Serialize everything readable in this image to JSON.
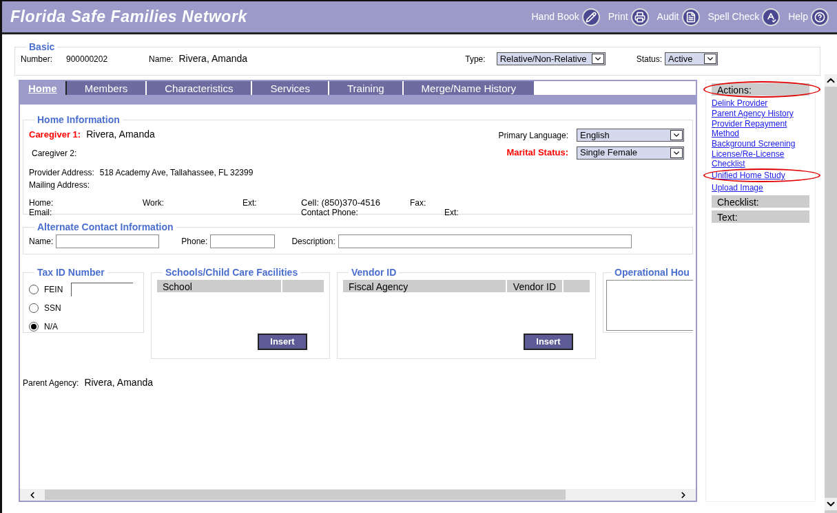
{
  "app": {
    "title": "Florida Safe Families Network"
  },
  "toolbar": [
    {
      "label": "Hand Book",
      "kind": "pencil"
    },
    {
      "label": "Print",
      "kind": "printer"
    },
    {
      "label": "Audit",
      "kind": "document"
    },
    {
      "label": "Spell Check",
      "kind": "spellcheck"
    },
    {
      "label": "Help",
      "kind": "help"
    }
  ],
  "basic": {
    "legend": "Basic",
    "number_label": "Number:",
    "number": "900000202",
    "name_label": "Name:",
    "name": "Rivera, Amanda",
    "type_label": "Type:",
    "type": "Relative/Non-Relative",
    "status_label": "Status:",
    "status": "Active"
  },
  "tabs": [
    {
      "label": "Home",
      "selected": true
    },
    {
      "label": "Members",
      "selected": false
    },
    {
      "label": "Characteristics",
      "selected": false
    },
    {
      "label": "Services",
      "selected": false
    },
    {
      "label": "Training",
      "selected": false
    },
    {
      "label": "Merge/Name History",
      "selected": false
    }
  ],
  "home_information": {
    "legend": "Home Information",
    "caregiver1_label": "Caregiver 1:",
    "caregiver1": "Rivera, Amanda",
    "caregiver2_label": "Caregiver 2:",
    "language_label": "Primary Language:",
    "language": "English",
    "marital_label": "Marital Status:",
    "marital": "Single Female",
    "provider_address_label": "Provider Address:",
    "provider_address": "518 Academy Ave, Tallahassee, FL 32399",
    "mailing_address_label": "Mailing Address:",
    "home_label": "Home:",
    "work_label": "Work:",
    "ext_label": "Ext:",
    "cell": "Cell: (850)370-4516",
    "fax_label": "Fax:",
    "email_label": "Email:",
    "contact_phone_label": "Contact Phone:",
    "ext2_label": "Ext:"
  },
  "alternate_contact": {
    "legend": "Alternate Contact Information",
    "name_label": "Name:",
    "phone_label": "Phone:",
    "description_label": "Description:"
  },
  "tax_id": {
    "legend": "Tax ID Number",
    "options": [
      {
        "label": "FEIN",
        "selected": false,
        "kind": "field"
      },
      {
        "label": "SSN",
        "selected": false,
        "kind": "plain"
      },
      {
        "label": "N/A",
        "selected": true,
        "kind": "plain"
      }
    ]
  },
  "schools": {
    "legend": "Schools/Child Care Facilities",
    "columns": [
      "School"
    ],
    "button": "Insert"
  },
  "vendor": {
    "legend": "Vendor ID",
    "columns": [
      "Fiscal Agency",
      "Vendor ID"
    ],
    "button": "Insert"
  },
  "operational_hours": {
    "legend": "Operational Hou"
  },
  "parent_agency": {
    "label": "Parent Agency:",
    "value": "Rivera, Amanda"
  },
  "sidebar": {
    "actions": {
      "label": "Actions:",
      "circled": true
    },
    "links": [
      {
        "label": "Delink Provider",
        "circled": false
      },
      {
        "label": "Parent Agency History",
        "circled": false
      },
      {
        "label": "Provider Repayment Method",
        "circled": false
      },
      {
        "label": "Background Screening",
        "circled": false
      },
      {
        "label": "License/Re-License Checklist",
        "circled": false
      },
      {
        "label": "Unified Home Study",
        "circled": true
      },
      {
        "label": "Upload Image",
        "circled": false
      }
    ],
    "sections": [
      "Checklist:",
      "Text:"
    ]
  }
}
